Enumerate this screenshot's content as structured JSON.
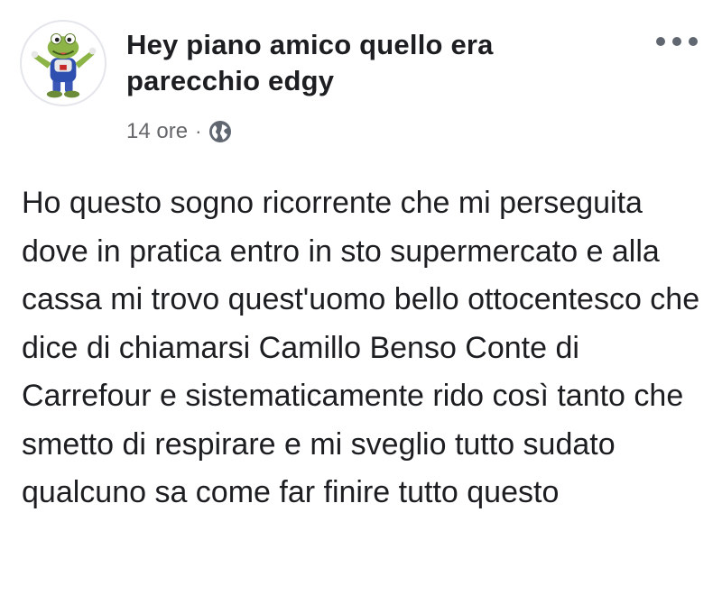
{
  "post": {
    "author": "Hey piano amico quello era parecchio edgy",
    "timestamp": "14 ore",
    "separator": "·",
    "privacy_icon": "globe-icon",
    "more_icon": "more-options-icon",
    "avatar_icon": "frog-avatar-icon",
    "text": "Ho questo sogno ricorrente che mi perseguita dove in pratica entro in sto supermercato e alla cassa mi trovo quest'uomo bello ottocentesco che dice di chiamarsi Camillo Benso Conte di Carrefour e sistematicamente rido così tanto che smetto di respirare e mi sveglio tutto sudato qualcuno sa come far finire tutto questo"
  },
  "colors": {
    "text": "#1c1e21",
    "meta": "#65676b",
    "icon": "#606770"
  }
}
